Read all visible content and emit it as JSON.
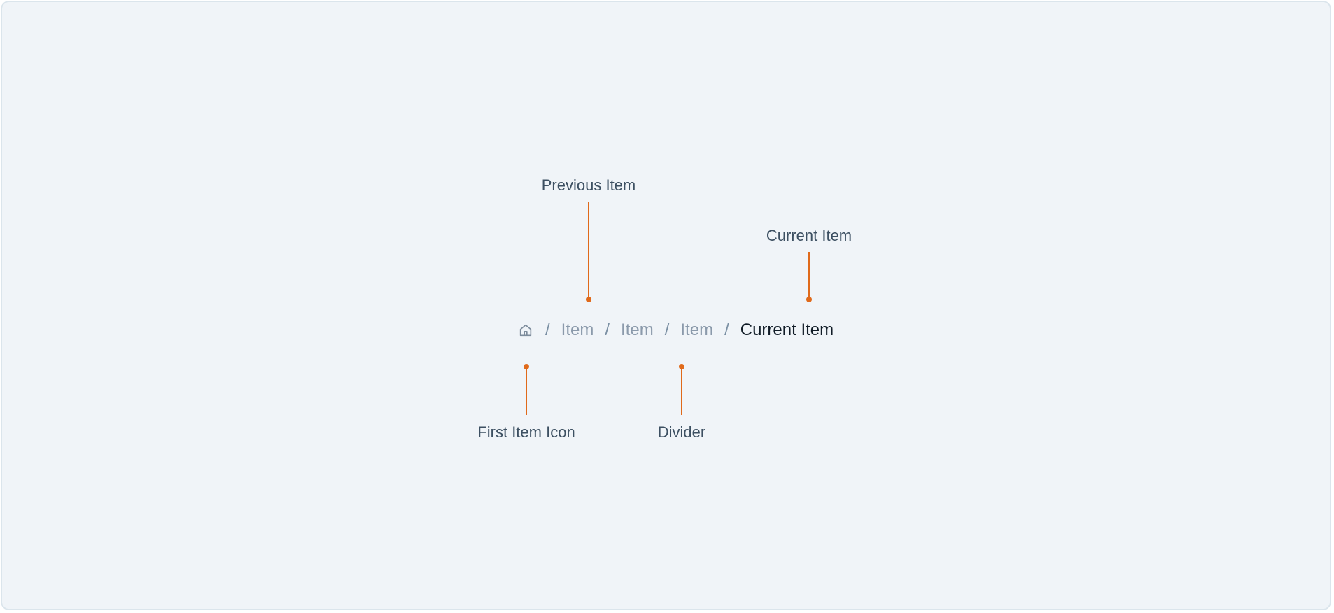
{
  "colors": {
    "canvas_background": "#f0f4f8",
    "canvas_border": "#dbe5ec",
    "annotation_accent": "#e06a1b",
    "annotation_text": "#3d5062",
    "breadcrumb_item": "#8b9aab",
    "breadcrumb_current": "#111c27",
    "divider": "#7a8fa3"
  },
  "breadcrumb": {
    "home_icon": "home-icon",
    "divider": "/",
    "items": [
      "Item",
      "Item",
      "Item"
    ],
    "current": "Current Item"
  },
  "annotations": {
    "previous_item": "Previous Item",
    "current_item": "Current Item",
    "first_item_icon": "First Item Icon",
    "divider": "Divider"
  }
}
